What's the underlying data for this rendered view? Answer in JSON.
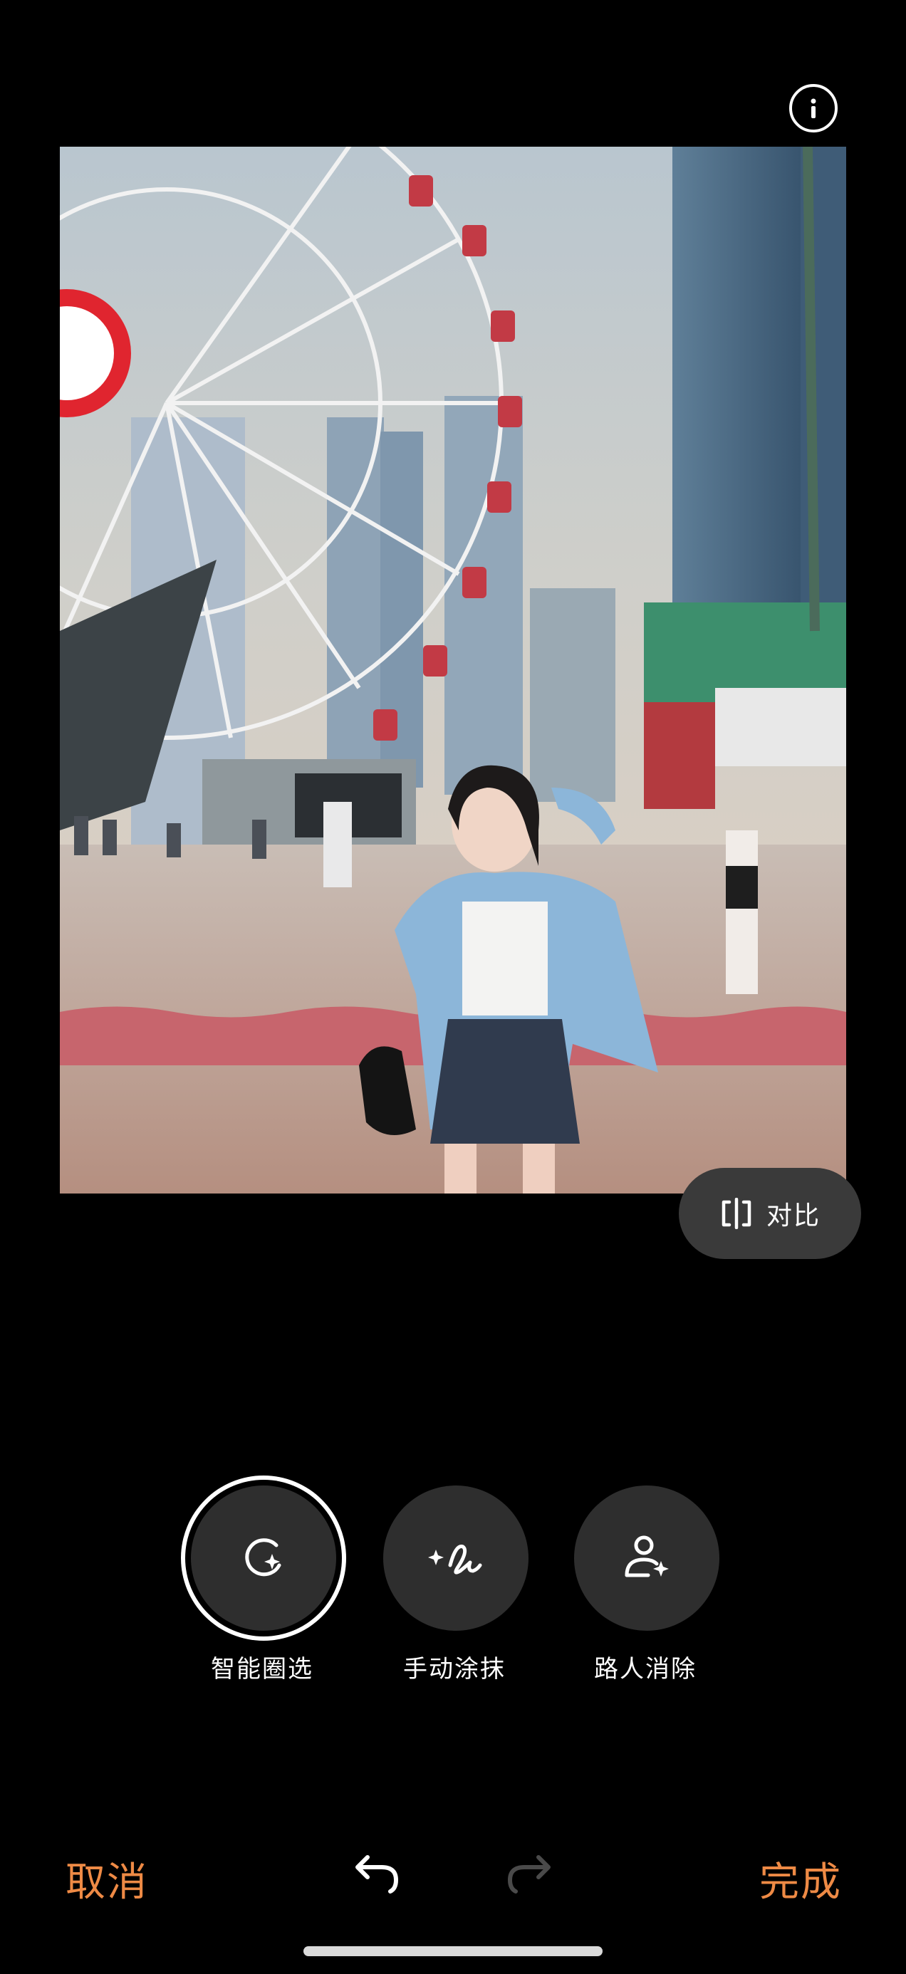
{
  "header": {
    "info_icon": "info-icon"
  },
  "photo": {
    "description_icon": "photo"
  },
  "compare": {
    "label": "对比",
    "icon": "compare-icon"
  },
  "tools": [
    {
      "label": "智能圈选",
      "icon": "smart-select-icon",
      "selected": true
    },
    {
      "label": "手动涂抹",
      "icon": "brush-icon",
      "selected": false
    },
    {
      "label": "路人消除",
      "icon": "remove-person-icon",
      "selected": false
    }
  ],
  "footer": {
    "cancel_label": "取消",
    "done_label": "完成",
    "undo_icon": "undo-icon",
    "redo_icon": "redo-icon"
  },
  "colors": {
    "accent": "#ee8a45",
    "tool_bg": "#2e2e2e",
    "pill_bg": "#3a3a3a"
  }
}
